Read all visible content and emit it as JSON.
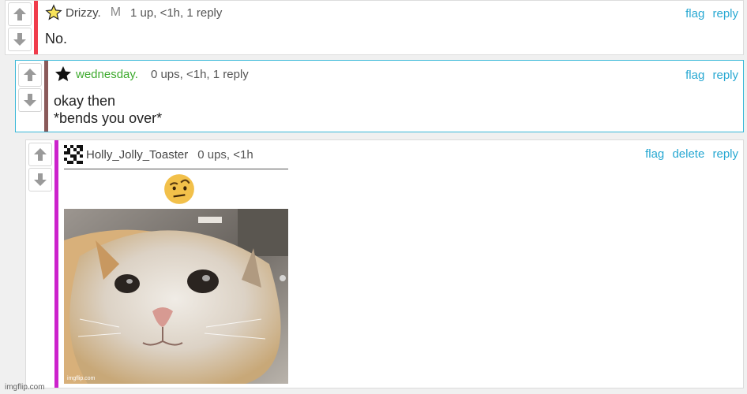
{
  "comments": [
    {
      "username": "Drizzy.",
      "mod_badge": "M",
      "meta": "1 up, <1h, 1 reply",
      "actions": [
        "flag",
        "reply"
      ],
      "body_lines": [
        "No."
      ],
      "accent_color": "#f03c4b"
    },
    {
      "username": "wednesday.",
      "meta": "0 ups, <1h, 1 reply",
      "actions": [
        "flag",
        "reply"
      ],
      "body_lines": [
        "okay then",
        "*bends you over*"
      ],
      "accent_color": "#8a5a5a",
      "username_color": "#3eaa2e",
      "highlight_border": "#39b8d8"
    },
    {
      "username": "Holly_Jolly_Toaster",
      "meta": "0 ups, <1h",
      "actions": [
        "flag",
        "delete",
        "reply"
      ],
      "accent_color": "#cc22cc",
      "image_watermark": "imgflip.com"
    }
  ],
  "icons": [
    "upvote-arrow-icon",
    "downvote-arrow-icon",
    "star-outline-icon",
    "star-filled-icon",
    "pixel-avatar-icon",
    "raised-eyebrow-emoji",
    "cat-photo"
  ],
  "footer": {
    "watermark": "imgflip.com"
  }
}
